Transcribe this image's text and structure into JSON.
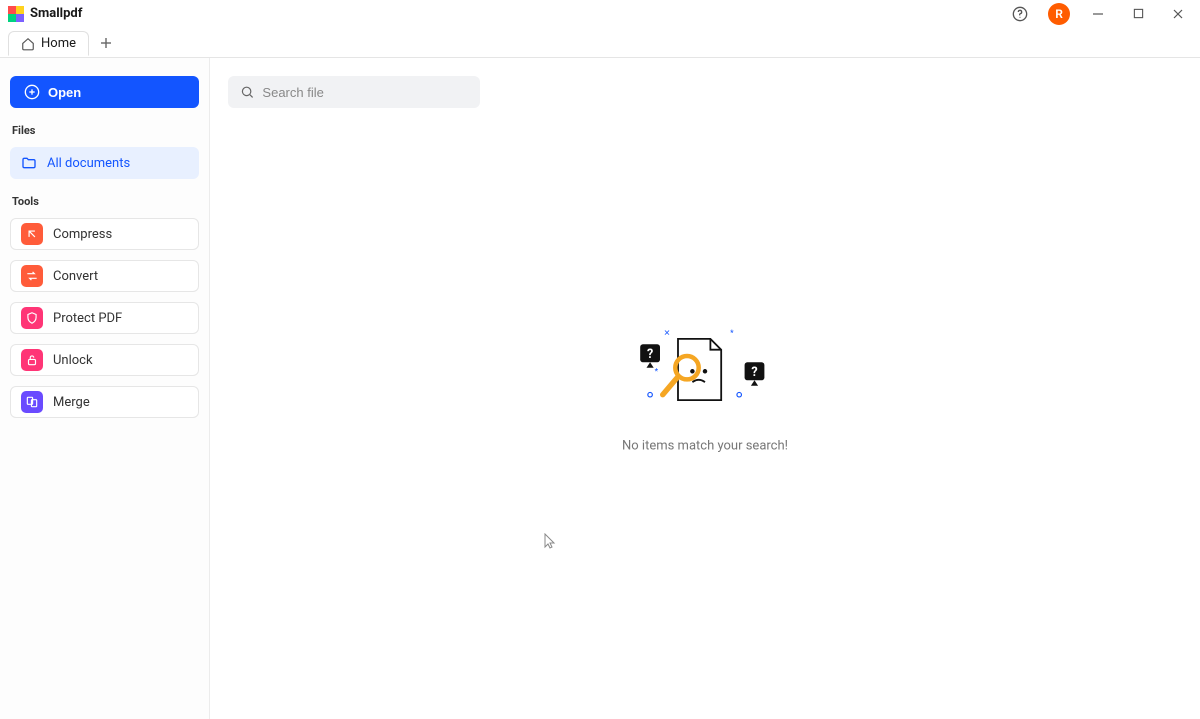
{
  "app": {
    "name": "Smallpdf",
    "avatar_initial": "R"
  },
  "tabs": {
    "home": "Home"
  },
  "sidebar": {
    "open_label": "Open",
    "files_section": "Files",
    "all_documents": "All documents",
    "tools_section": "Tools",
    "tools": {
      "compress": "Compress",
      "convert": "Convert",
      "protect": "Protect PDF",
      "unlock": "Unlock",
      "merge": "Merge"
    }
  },
  "search": {
    "placeholder": "Search file"
  },
  "empty_state": {
    "message": "No items match your search!"
  }
}
